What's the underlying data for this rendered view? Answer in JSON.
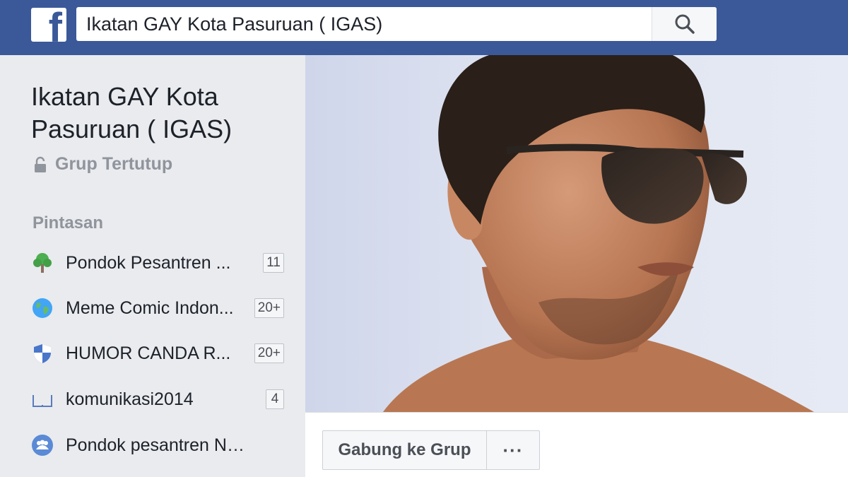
{
  "header": {
    "logo_icon": "facebook-f-logo",
    "search": {
      "value": "Ikatan GAY Kota Pasuruan ( IGAS)",
      "icon": "search-icon"
    },
    "bar_color": "#3b5998"
  },
  "group": {
    "title": "Ikatan GAY Kota Pasuruan ( IGAS)",
    "privacy": {
      "icon": "lock-icon",
      "label": "Grup Tertutup"
    }
  },
  "shortcuts": {
    "label": "Pintasan",
    "items": [
      {
        "icon": "tree-icon",
        "label": "Pondok Pesantren ...",
        "count": "11"
      },
      {
        "icon": "globe-icon",
        "label": "Meme Comic Indon...",
        "count": "20+"
      },
      {
        "icon": "shield-icon",
        "label": "HUMOR CANDA R...",
        "count": "20+"
      },
      {
        "icon": "book-icon",
        "label": "komunikasi2014",
        "count": "4"
      },
      {
        "icon": "group-icon",
        "label": "Pondok pesantren NGA...",
        "count": ""
      }
    ]
  },
  "cover": {
    "description_icon": "cover-photo-man-sunglasses"
  },
  "actions": {
    "join_label": "Gabung ke Grup",
    "more_label": "···"
  }
}
